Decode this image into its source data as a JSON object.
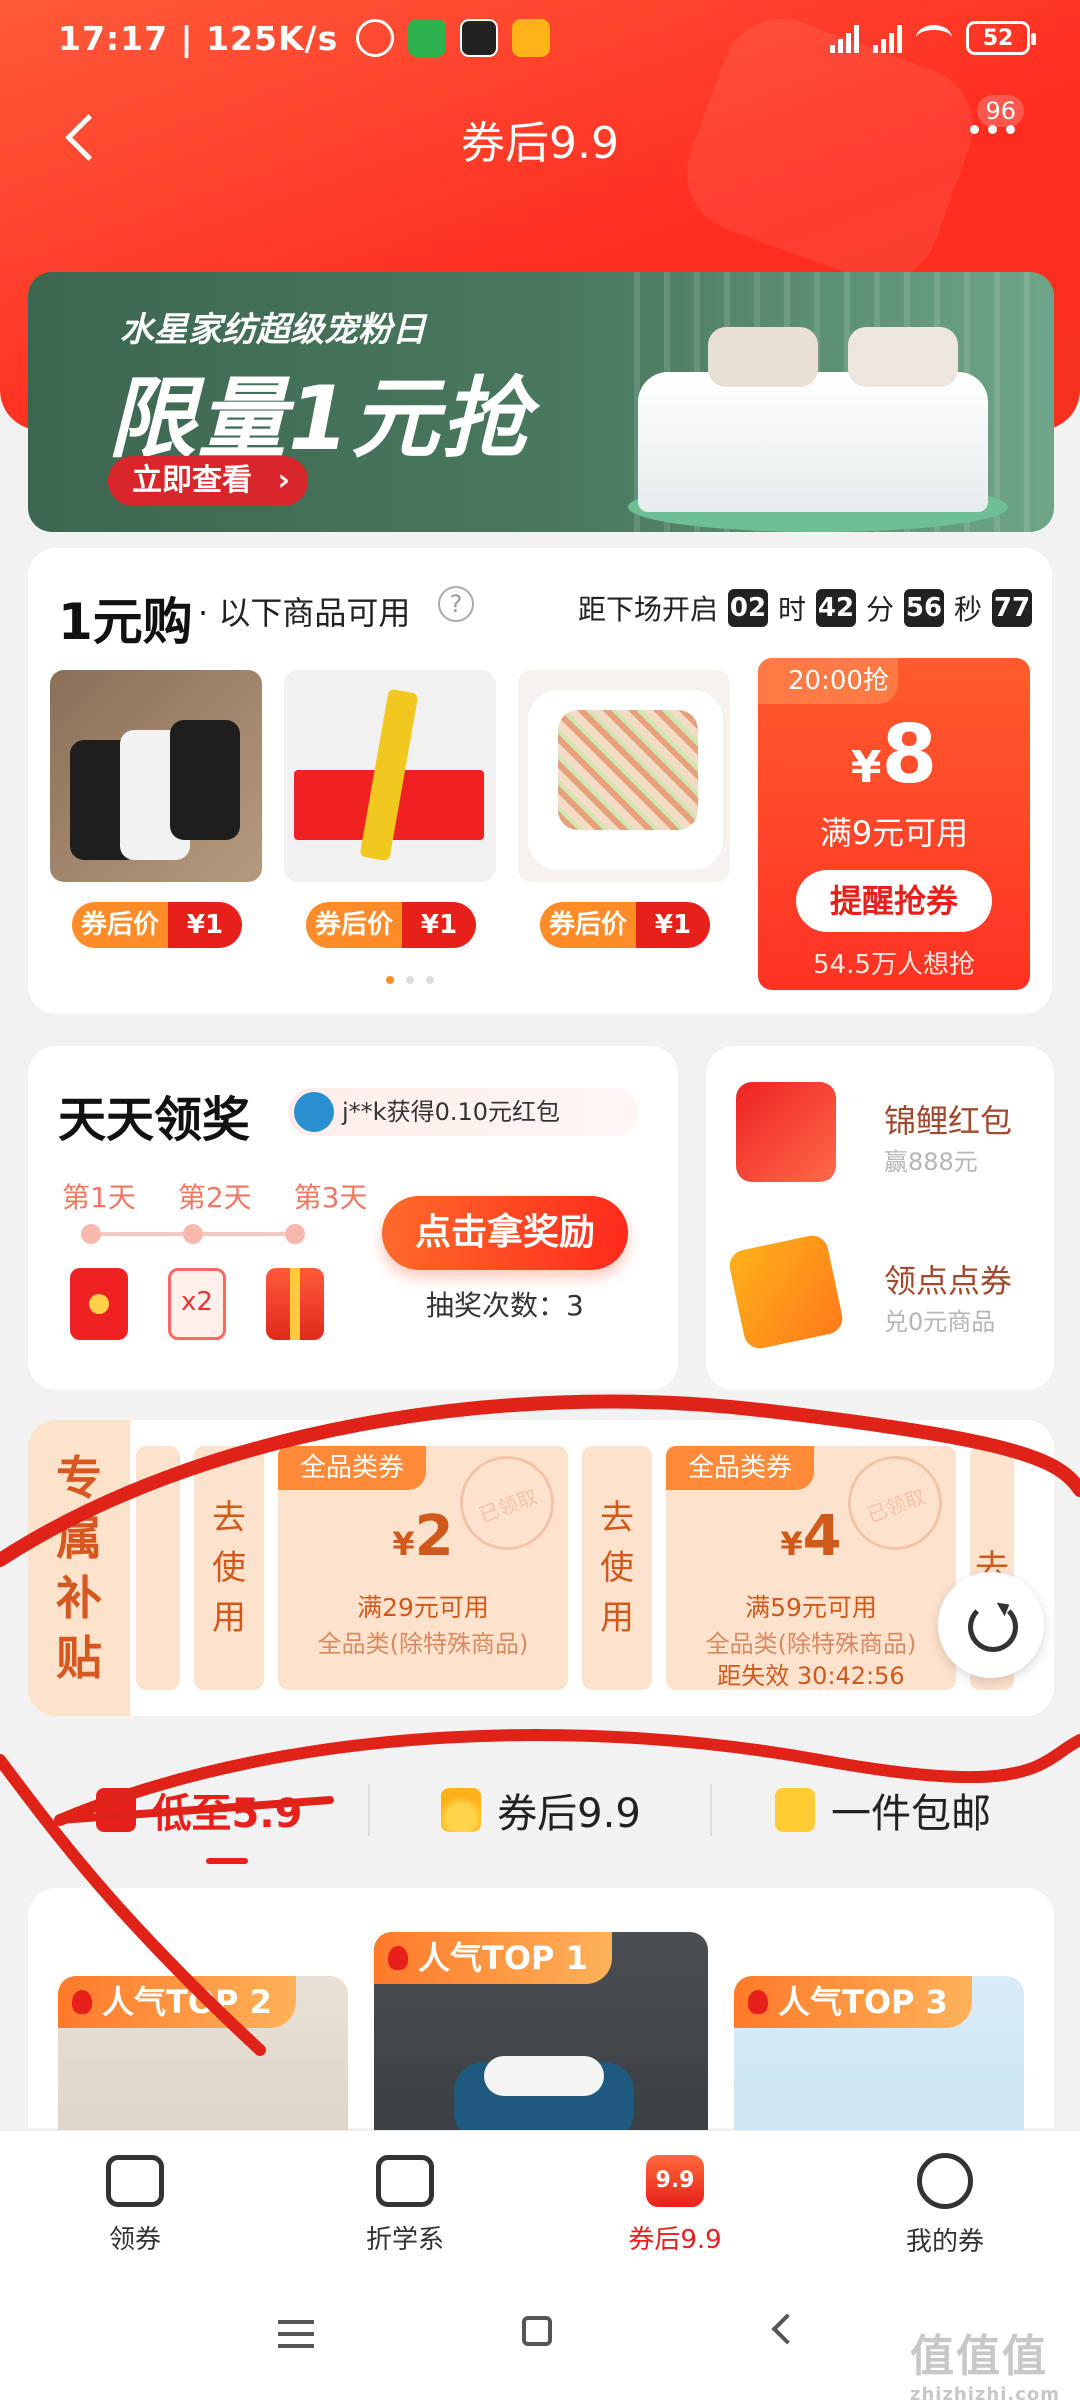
{
  "status_bar": {
    "time": "17:17",
    "speed": "125K/s",
    "battery": "52"
  },
  "header": {
    "title": "券后9.9",
    "more_badge": "96"
  },
  "banner": {
    "subtitle": "水星家纺超级宠粉日",
    "headline": "限量1元抢",
    "cta": "立即查看"
  },
  "one_yuan": {
    "title": "1元购",
    "subtitle": "· 以下商品可用",
    "countdown_label": "距下场开启",
    "hours": "02",
    "hours_unit": "时",
    "minutes": "42",
    "minutes_unit": "分",
    "seconds": "56",
    "seconds_unit": "秒",
    "ms": "77",
    "products": [
      {
        "price_label": "券后价",
        "price": "¥1"
      },
      {
        "price_label": "券后价",
        "price": "¥1"
      },
      {
        "price_label": "券后价",
        "price": "¥1"
      }
    ],
    "coupon": {
      "time": "20:00抢",
      "currency": "¥",
      "amount": "8",
      "condition": "满9元可用",
      "button": "提醒抢券",
      "interest": "54.5万人想抢"
    }
  },
  "daily": {
    "title": "天天领奖",
    "notice": "j**k获得0.10元红包",
    "days": [
      "第1天",
      "第2天",
      "第3天"
    ],
    "x2": "x2",
    "button": "点击拿奖励",
    "draws": "抽奖次数：3"
  },
  "side": {
    "items": [
      {
        "name": "锦鲤红包",
        "desc": "赢888元"
      },
      {
        "name": "领点点券",
        "desc": "兑0元商品"
      }
    ]
  },
  "subsidy": {
    "tag": [
      "专",
      "属",
      "补",
      "贴"
    ],
    "use": [
      "去",
      "使",
      "用"
    ],
    "coupons": [
      {
        "tag": "全品类券",
        "currency": "¥",
        "amount": "2",
        "cond": "满29元可用",
        "scope": "全品类(除特殊商品)",
        "expire": "",
        "stamp": "已领取"
      },
      {
        "tag": "全品类券",
        "currency": "¥",
        "amount": "4",
        "cond": "满59元可用",
        "scope": "全品类(除特殊商品)",
        "expire": "距失效 30:42:56",
        "stamp": "已领取"
      }
    ]
  },
  "tabs": [
    {
      "label": "低至5.9"
    },
    {
      "label": "券后9.9"
    },
    {
      "label": "一件包邮"
    }
  ],
  "list": [
    {
      "label": "人气TOP 2"
    },
    {
      "label": "人气TOP 1"
    },
    {
      "label": "人气TOP 3"
    }
  ],
  "bottom_nav": [
    {
      "label": "领券",
      "icon": "coupon-icon"
    },
    {
      "label": "折学系",
      "icon": "z-icon"
    },
    {
      "label": "券后9.9",
      "icon_text": "9.9"
    },
    {
      "label": "我的券",
      "icon": "smile-icon"
    }
  ],
  "watermark": {
    "main": "值值值",
    "sub": "zhizhizhi.com"
  },
  "colors": {
    "accent": "#e8201b",
    "orange": "#ff8b29",
    "banner": "#3d6650"
  }
}
